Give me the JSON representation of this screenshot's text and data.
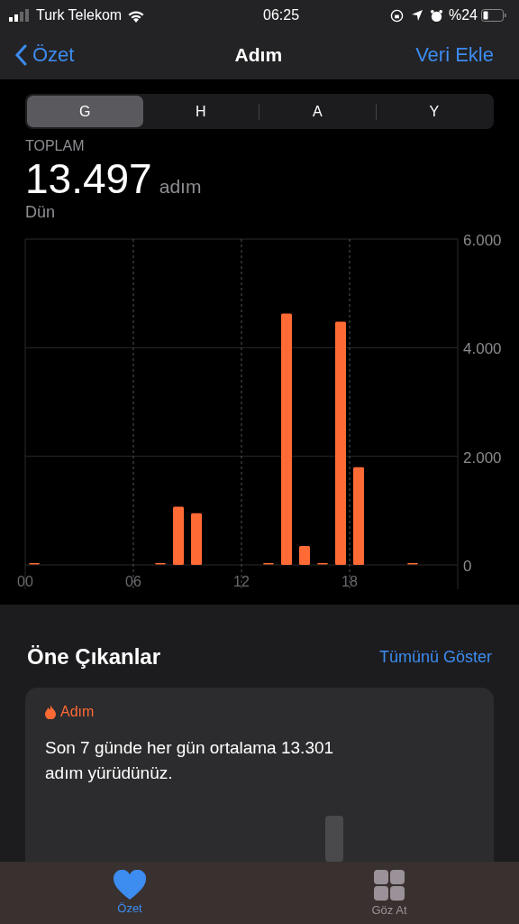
{
  "status_bar": {
    "carrier": "Turk Telekom",
    "time": "06:25",
    "battery": "%24"
  },
  "nav": {
    "back": "Özet",
    "title": "Adım",
    "action": "Veri Ekle"
  },
  "segments": [
    {
      "label": "G",
      "selected": true
    },
    {
      "label": "H",
      "selected": false
    },
    {
      "label": "A",
      "selected": false
    },
    {
      "label": "Y",
      "selected": false
    }
  ],
  "summary": {
    "label": "TOPLAM",
    "value": "13.497",
    "unit": "adım",
    "date": "Dün"
  },
  "chart_data": {
    "type": "bar",
    "x": [
      0.5,
      7.5,
      8.5,
      9.5,
      13.5,
      14.5,
      15.5,
      16.5,
      17.5,
      18.5,
      21.5
    ],
    "xlim": [
      0,
      24
    ],
    "grid": true,
    "series": [
      {
        "color": "#ff6a35",
        "values": [
          10,
          10,
          1070,
          950,
          10,
          4630,
          350,
          10,
          4480,
          1800,
          10
        ]
      }
    ],
    "ylim": [
      0,
      6000
    ],
    "yticks": [
      {
        "value": 0,
        "label": "0"
      },
      {
        "value": 2000,
        "label": "2.000"
      },
      {
        "value": 4000,
        "label": "4.000"
      },
      {
        "value": 6000,
        "label": "6.000"
      }
    ],
    "xticks": [
      {
        "value": 0,
        "label": "00"
      },
      {
        "value": 6,
        "label": "06"
      },
      {
        "value": 12,
        "label": "12"
      },
      {
        "value": 18,
        "label": "18"
      }
    ]
  },
  "highlights": {
    "title": "Öne Çıkanlar",
    "action": "Tümünü Göster",
    "card": {
      "category": "Adım",
      "text": "Son 7 günde her gün ortalama 13.301 adım yürüdünüz."
    }
  },
  "tab_bar": [
    {
      "label": "Özet",
      "selected": true
    },
    {
      "label": "Göz At",
      "selected": false
    }
  ]
}
